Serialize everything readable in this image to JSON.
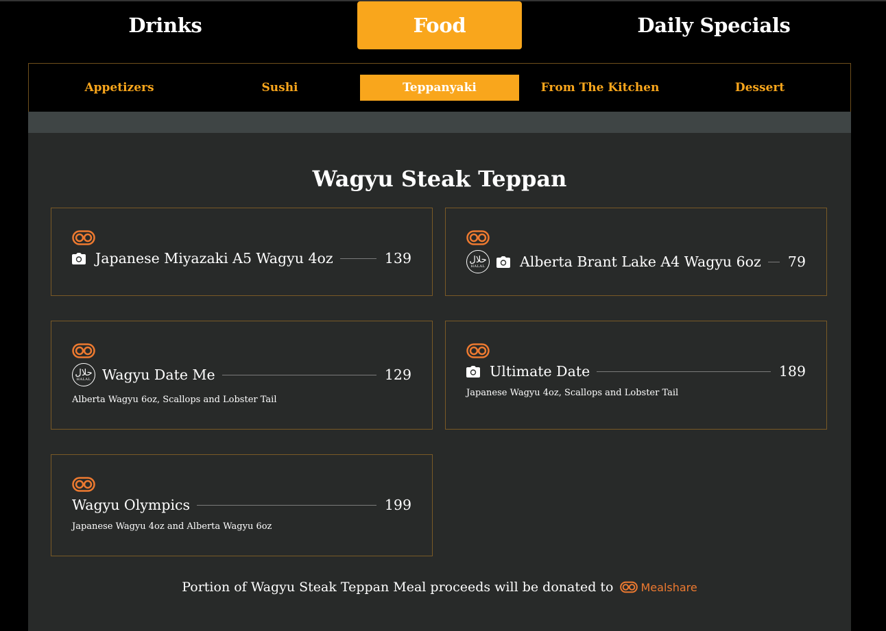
{
  "main_tabs": [
    {
      "label": "Drinks",
      "active": false
    },
    {
      "label": "Food",
      "active": true
    },
    {
      "label": "Daily Specials",
      "active": false
    }
  ],
  "sub_tabs": [
    {
      "label": "Appetizers",
      "active": false
    },
    {
      "label": "Sushi",
      "active": false
    },
    {
      "label": "Teppanyaki",
      "active": true
    },
    {
      "label": "From The Kitchen",
      "active": false
    },
    {
      "label": "Dessert",
      "active": false
    }
  ],
  "section": {
    "title": "Wagyu Steak Teppan"
  },
  "items": [
    {
      "name": "Japanese Miyazaki A5 Wagyu 4oz",
      "price": "139",
      "desc": "",
      "halal": false,
      "photo": true,
      "halal_ar": "",
      "halal_en": ""
    },
    {
      "name": "Alberta Brant Lake A4 Wagyu 6oz",
      "price": "79",
      "desc": "",
      "halal": true,
      "photo": true,
      "halal_ar": "حلال",
      "halal_en": "HALAL"
    },
    {
      "name": "Wagyu Date Me",
      "price": "129",
      "desc": "Alberta Wagyu 6oz, Scallops and Lobster Tail",
      "halal": true,
      "photo": false,
      "halal_ar": "حلال",
      "halal_en": "HALAL"
    },
    {
      "name": "Ultimate Date",
      "price": "189",
      "desc": "Japanese Wagyu 4oz, Scallops and Lobster Tail",
      "halal": false,
      "photo": true,
      "halal_ar": "",
      "halal_en": ""
    },
    {
      "name": "Wagyu Olympics",
      "price": "199",
      "desc": "Japanese Wagyu 4oz and Alberta Wagyu 6oz",
      "halal": false,
      "photo": false,
      "halal_ar": "",
      "halal_en": ""
    }
  ],
  "icons": {
    "mealshare": "mealshare-icon",
    "camera": "camera-icon",
    "halal": "halal-badge-icon"
  },
  "footer": {
    "note": "Portion of Wagyu Steak Teppan Meal proceeds will be donated to",
    "logo_text": "Mealshare"
  },
  "colors": {
    "accent": "#f9a61c",
    "mealshare": "#ee7a30",
    "panel": "#282a29",
    "border": "#7a5a26"
  }
}
